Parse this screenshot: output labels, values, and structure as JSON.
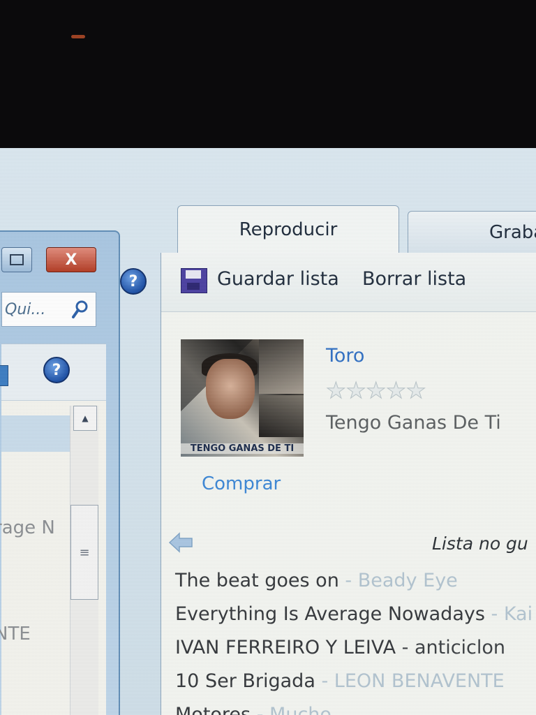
{
  "left_window": {
    "close_glyph": "X",
    "search_placeholder": "Qui...",
    "help_glyph": "?",
    "scroll_up_glyph": "▲",
    "scroll_grip_glyph": "≡",
    "list_fragment_1": "rage N",
    "list_fragment_2": "NTE"
  },
  "main": {
    "help_glyph": "?",
    "tabs": [
      {
        "label": "Reproducir"
      },
      {
        "label": "Graba"
      }
    ],
    "toolbar": {
      "save_label": "Guardar lista",
      "clear_label": "Borrar lista"
    },
    "now_playing": {
      "album_art_text": "TENGO GANAS DE TI",
      "buy_label": "Comprar",
      "artist": "Toro",
      "rating_stars": 0,
      "rating_max": 5,
      "title": "Tengo Ganas De Ti"
    },
    "list_status": "Lista no gu",
    "playlist": [
      {
        "title": "The beat goes on",
        "sep": " - ",
        "artist": "Beady Eye"
      },
      {
        "title": "Everything Is Average Nowadays",
        "sep": " - ",
        "artist": "Kai"
      },
      {
        "title": "IVAN FERREIRO Y LEIVA",
        "sep": " - ",
        "artist": "anticiclon"
      },
      {
        "title": "10 Ser Brigada",
        "sep": " - ",
        "artist": "LEON BENAVENTE"
      },
      {
        "title": "Motores",
        "sep": " - ",
        "artist": "Mucho"
      }
    ]
  }
}
